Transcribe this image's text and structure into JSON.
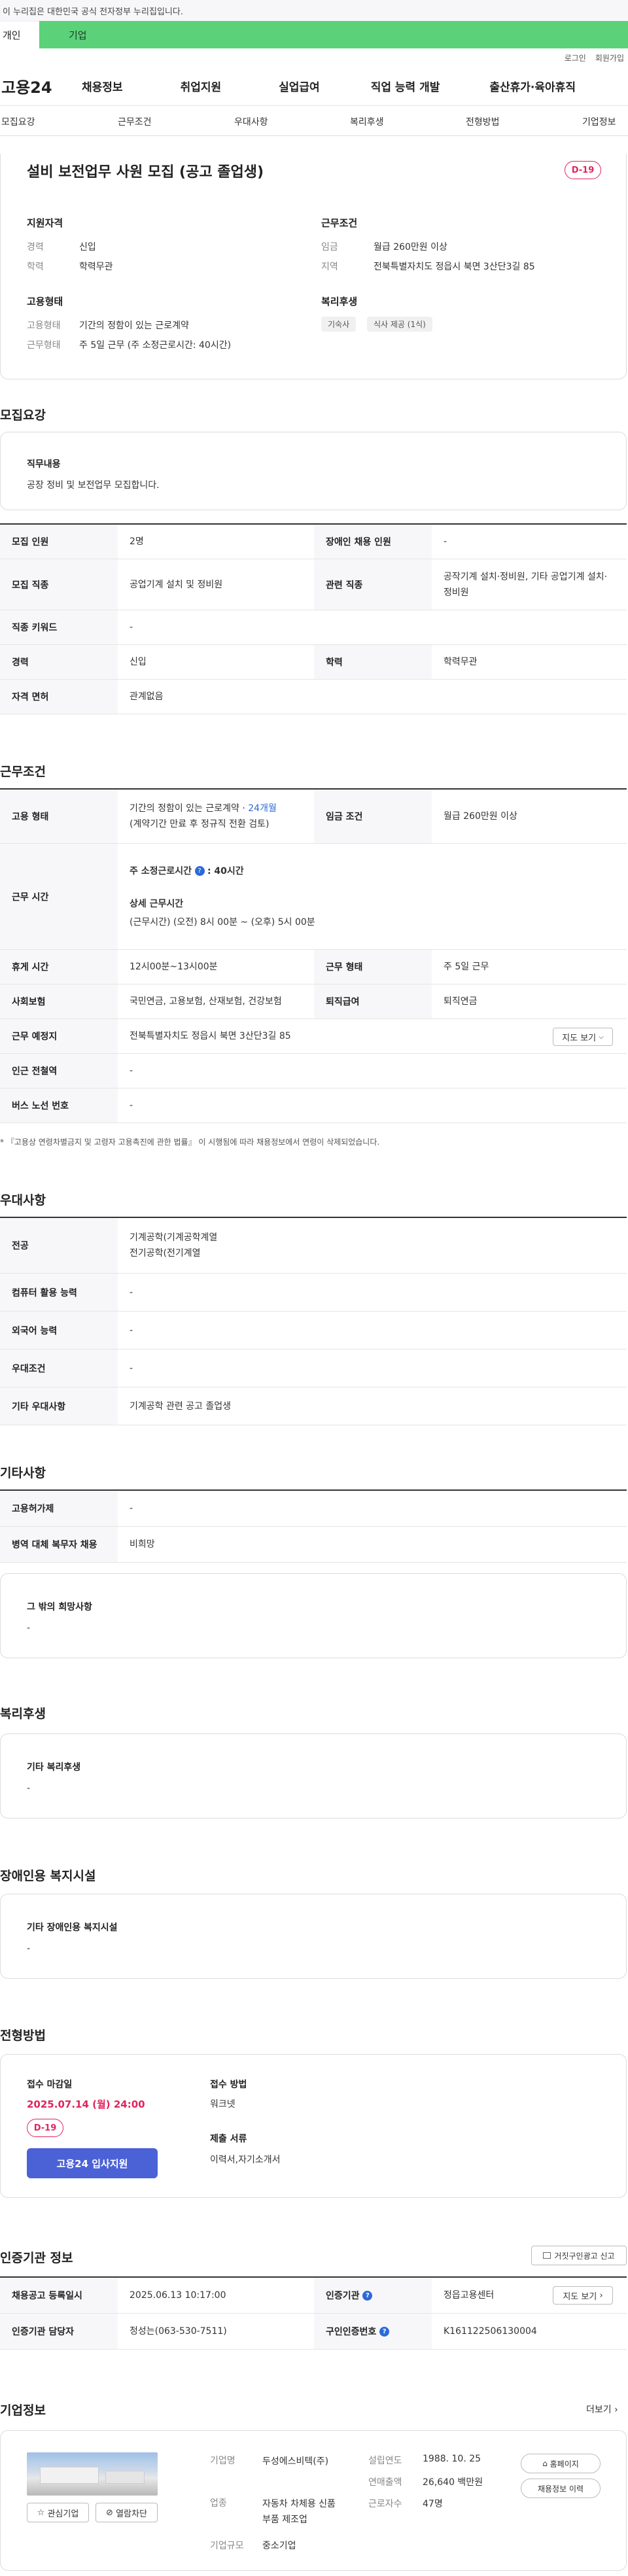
{
  "banner": {
    "text": "이 누리집은 대한민국 공식 전자정부 누리집입니다."
  },
  "topTabs": {
    "personal": "개인",
    "company": "기업"
  },
  "utils": {
    "login": "로그인",
    "join": "회원가입"
  },
  "logo": "고용24",
  "gnb": [
    "채용정보",
    "취업지원",
    "실업급여",
    "직업 능력 개발",
    "출산휴가·육아휴직"
  ],
  "snb": [
    "모집요강",
    "근무조건",
    "우대사항",
    "복리후생",
    "전형방법",
    "기업정보"
  ],
  "summary": {
    "title": "설비 보전업무 사원 모집 (공고 졸업생)",
    "dday": "D-19",
    "qual": {
      "heading": "지원자격",
      "careerLabel": "경력",
      "career": "신입",
      "eduLabel": "학력",
      "edu": "학력무관"
    },
    "work": {
      "heading": "근무조건",
      "wageLabel": "임금",
      "wage": "월급 260만원 이상",
      "areaLabel": "지역",
      "area": "전북특별자치도 정읍시 북면 3산단3길 85"
    },
    "emp": {
      "heading": "고용형태",
      "typeLabel": "고용형태",
      "type": "기간의 정함이 있는 근로계약",
      "shapeLabel": "근무형태",
      "shape": "주 5일 근무 (주 소정근로시간: 40시간)"
    },
    "welfare": {
      "heading": "복리후생",
      "chips": [
        "기숙사",
        "식사 제공 (1식)"
      ]
    }
  },
  "recruit": {
    "title": "모집요강",
    "dutyLabel": "직무내용",
    "duty": "공장 정비 및 보전업무 모집합니다.",
    "rows": [
      {
        "k1": "모집 인원",
        "v1": "2명",
        "k2": "장애인 채용 인원",
        "v2": "-"
      },
      {
        "k1": "모집 직종",
        "v1": "공업기계 설치 및 정비원",
        "k2": "관련 직종",
        "v2": "공작기계 설치·정비원, 기타 공업기계 설치·정비원"
      },
      {
        "k1": "직종 키워드",
        "v1": "-"
      },
      {
        "k1": "경력",
        "v1": "신입",
        "k2": "학력",
        "v2": "학력무관"
      },
      {
        "k1": "자격 면허",
        "v1": "관계없음"
      }
    ]
  },
  "cond": {
    "title": "근무조건",
    "empTypeLabel": "고용 형태",
    "empType": "기간의 정함이 있는 근로계약 · ",
    "empMonths": "24개월",
    "empNote": "(계약기간 만료 후 정규직 전환 검토)",
    "wageLabel": "임금 조건",
    "wage": "월급 260만원 이상",
    "hoursLabel": "근무 시간",
    "weeklyLabel": "주 소정근로시간",
    "weekly": ": 40시간",
    "detailLabel": "상세 근무시간",
    "detail": "(근무시간) (오전) 8시 00분 ~ (오후) 5시 00분",
    "breakLabel": "휴게 시간",
    "break": "12시00분~13시00분",
    "shapeLabel": "근무 형태",
    "shape": "주 5일 근무",
    "insLabel": "사회보험",
    "ins": "국민연금, 고용보험, 산재보험, 건강보험",
    "retLabel": "퇴직급여",
    "ret": "퇴직연금",
    "placeLabel": "근무 예정지",
    "place": "전북특별자치도 정읍시 북면 3산단3길 85",
    "mapBtn": "지도 보기",
    "subwayLabel": "인근 전철역",
    "subway": "-",
    "busLabel": "버스 노선 번호",
    "bus": "-",
    "notice": "* 『고용상 연령차별금지 및 고령자 고용촉진에 관한 법률』 이 시행됨에 따라 채용정보에서 연령이 삭제되었습니다."
  },
  "pref": {
    "title": "우대사항",
    "rows": [
      {
        "k": "전공",
        "v": [
          "기계공학(기계공학계열",
          "전기공학(전기계열"
        ]
      },
      {
        "k": "컴퓨터 활용 능력",
        "v": [
          "-"
        ]
      },
      {
        "k": "외국어 능력",
        "v": [
          "-"
        ]
      },
      {
        "k": "우대조건",
        "v": [
          "-"
        ]
      },
      {
        "k": "기타 우대사항",
        "v": [
          "기계공학 관련 공고 졸업생"
        ]
      }
    ]
  },
  "etc": {
    "title": "기타사항",
    "rows": [
      {
        "k": "고용허가제",
        "v": "-"
      },
      {
        "k": "병역 대체 복무자 채용",
        "v": "비희망"
      }
    ],
    "hopeLabel": "그 밖의 희망사항",
    "hope": "-"
  },
  "welfare": {
    "title": "복리후생",
    "label": "기타 복리후생",
    "val": "-"
  },
  "disab": {
    "title": "장애인용 복지시설",
    "label": "기타 장애인용 복지시설",
    "val": "-"
  },
  "screening": {
    "title": "전형방법",
    "deadlineLabel": "접수 마감일",
    "deadline": "2025.07.14 (월) 24:00",
    "dday": "D-19",
    "applyBtn": "고용24 입사지원",
    "methodLabel": "접수 방법",
    "method": "워크넷",
    "docsLabel": "제출 서류",
    "docs": "이력서,자기소개서"
  },
  "cert": {
    "title": "인증기관 정보",
    "reportBtn": "거짓구인광고 신고",
    "regLabel": "채용공고 등록일시",
    "reg": "2025.06.13 10:17:00",
    "orgLabel": "인증기관",
    "org": "정읍고용센터",
    "mapBtn": "지도 보기",
    "mgrLabel": "인증기관 담당자",
    "mgr": "정성는(063-530-7511)",
    "certNoLabel": "구인인증번호",
    "certNo": "K161122506130004"
  },
  "company": {
    "title": "기업정보",
    "more": "더보기",
    "likeBtn": "관심기업",
    "blockBtn": "열람차단",
    "nameLabel": "기업명",
    "name": "두성에스비텍(주)",
    "industryLabel": "업종",
    "industry": "자동차 차체용 신품 부품 제조업",
    "sizeLabel": "기업규모",
    "size": "중소기업",
    "foundLabel": "설립연도",
    "found": "1988. 10. 25",
    "salesLabel": "연매출액",
    "sales": "26,640 백만원",
    "empLabel": "근로자수",
    "emp": "47명",
    "homeBtn": "홈페이지",
    "historyBtn": "채용정보 이력"
  }
}
